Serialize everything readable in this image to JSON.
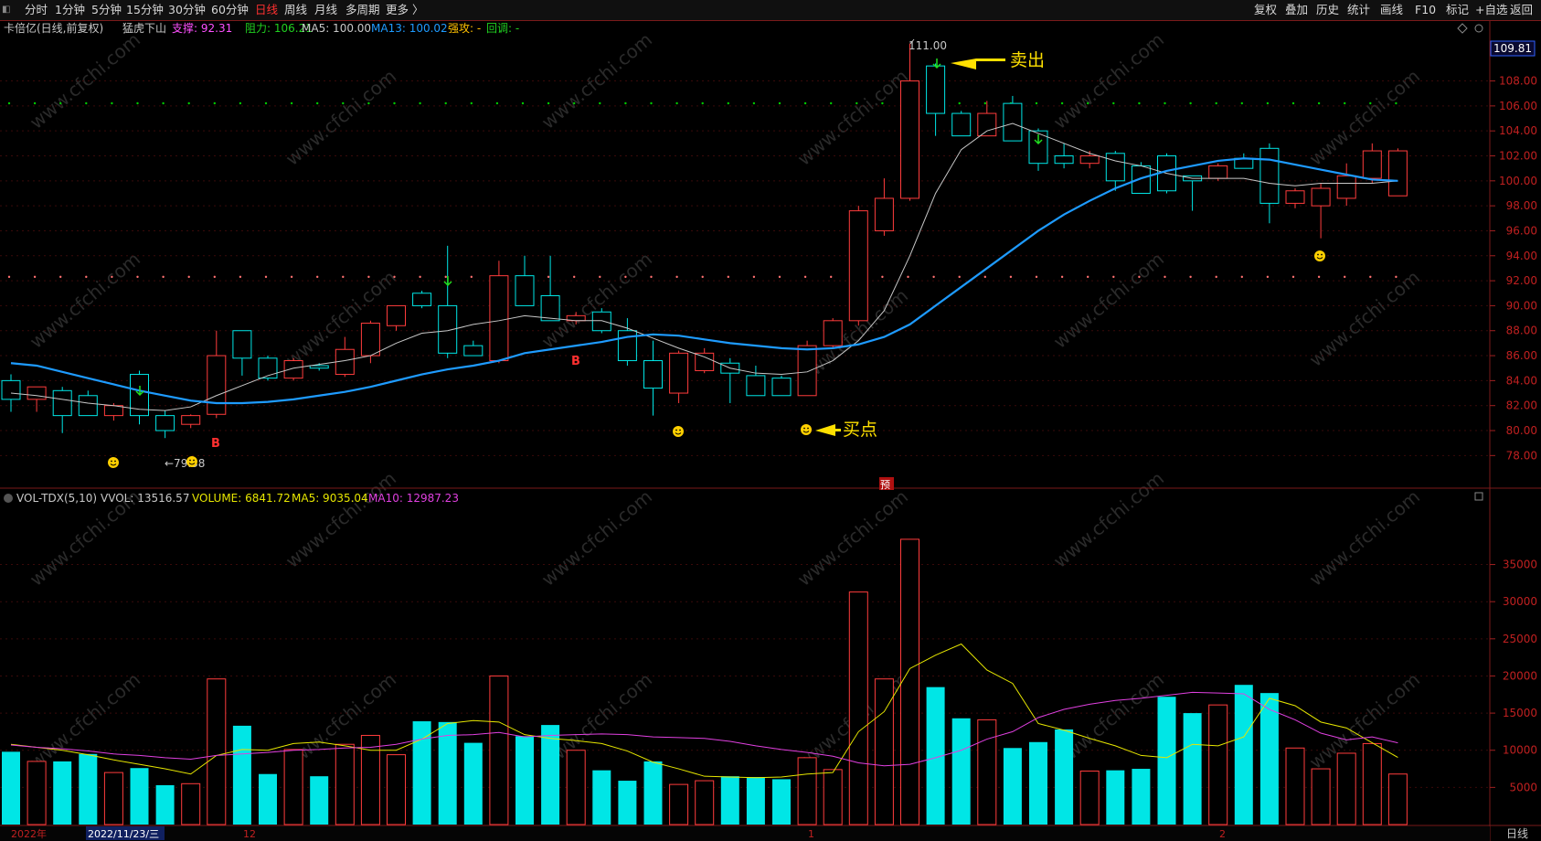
{
  "toolbar": {
    "periods": [
      "分时",
      "1分钟",
      "5分钟",
      "15分钟",
      "30分钟",
      "60分钟",
      "日线",
      "周线",
      "月线",
      "多周期",
      "更多 〉"
    ],
    "active": "日线",
    "right": [
      "复权",
      "叠加",
      "历史",
      "统计",
      "画线",
      "F10",
      "标记",
      "+自选",
      "返回"
    ]
  },
  "main_header": {
    "title": "卡倍亿(日线,前复权)",
    "indicator": "猛虎下山",
    "support": "支撑: 92.31",
    "resistance": "阻力: 106.21",
    "ma5": "MA5: 100.00",
    "ma13": "MA13: 100.02",
    "strong": "强攻: -",
    "pullback": "回调: -"
  },
  "vol_header": {
    "name": "VOL-TDX(5,10)",
    "vvol": "VVOL: 13516.57",
    "volume": "VOLUME: 6841.72",
    "ma5": "MA5: 9035.04",
    "ma10": "MA10: 12987.23"
  },
  "annotations": {
    "sell": "卖出",
    "buy": "买点",
    "high": "111.00",
    "low": "←79.38",
    "b_mark": "B",
    "pre_mark": "预",
    "current_price": "109.81"
  },
  "x_axis": {
    "labels": [
      "2022年",
      "2022/11/23/三",
      "12",
      "1",
      "2"
    ],
    "period": "日线"
  },
  "watermark": "www.cfchi.com",
  "colors": {
    "up": "#ff3c3c",
    "down": "#00e6e6",
    "ma5": "#c8c8c8",
    "ma13": "#1e9bff",
    "vol_ma5": "#e6e600",
    "vol_ma10": "#e040e0",
    "support_dots": "#00cc00",
    "resist_dots": "#ff7070",
    "arrow": "#ffe000"
  },
  "chart_data": [
    {
      "type": "candlestick",
      "title": "卡倍亿(日线,前复权)",
      "ylim": [
        77,
        110.5
      ],
      "yticks": [
        78,
        80,
        82,
        84,
        86,
        88,
        90,
        92,
        94,
        96,
        98,
        100,
        102,
        104,
        106,
        108
      ],
      "support": 92.31,
      "resistance": 106.21,
      "candles": [
        {
          "o": 84,
          "h": 84.5,
          "l": 81.5,
          "c": 82.5
        },
        {
          "o": 82.5,
          "h": 83.5,
          "l": 81.5,
          "c": 83.5
        },
        {
          "o": 83.2,
          "h": 83.5,
          "l": 79.8,
          "c": 81.2
        },
        {
          "o": 82.8,
          "h": 83.2,
          "l": 81.2,
          "c": 81.2
        },
        {
          "o": 81.2,
          "h": 82.2,
          "l": 80.8,
          "c": 82
        },
        {
          "o": 84.5,
          "h": 84.8,
          "l": 80.5,
          "c": 81.2
        },
        {
          "o": 81.2,
          "h": 81.6,
          "l": 79.4,
          "c": 80
        },
        {
          "o": 80.5,
          "h": 81.3,
          "l": 80.2,
          "c": 81.2
        },
        {
          "o": 81.3,
          "h": 88,
          "l": 81,
          "c": 86
        },
        {
          "o": 88,
          "h": 88,
          "l": 84.4,
          "c": 85.8
        },
        {
          "o": 85.8,
          "h": 86,
          "l": 84,
          "c": 84.2
        },
        {
          "o": 84.2,
          "h": 85.8,
          "l": 84,
          "c": 85.6
        },
        {
          "o": 85.2,
          "h": 85.4,
          "l": 84.8,
          "c": 85
        },
        {
          "o": 84.5,
          "h": 87.5,
          "l": 84.3,
          "c": 86.5
        },
        {
          "o": 86,
          "h": 88.8,
          "l": 85.4,
          "c": 88.6
        },
        {
          "o": 88.4,
          "h": 90,
          "l": 88,
          "c": 90
        },
        {
          "o": 91,
          "h": 91.2,
          "l": 89.8,
          "c": 90
        },
        {
          "o": 90,
          "h": 94.8,
          "l": 85.8,
          "c": 86.2
        },
        {
          "o": 86.8,
          "h": 87.2,
          "l": 86,
          "c": 86
        },
        {
          "o": 85.6,
          "h": 93.6,
          "l": 85.4,
          "c": 92.4
        },
        {
          "o": 92.4,
          "h": 94,
          "l": 90.2,
          "c": 90
        },
        {
          "o": 90.8,
          "h": 94,
          "l": 89.4,
          "c": 88.8
        },
        {
          "o": 88.8,
          "h": 89.5,
          "l": 88.5,
          "c": 89.2
        },
        {
          "o": 89.5,
          "h": 89.8,
          "l": 87.8,
          "c": 88
        },
        {
          "o": 88,
          "h": 89,
          "l": 85.2,
          "c": 85.6
        },
        {
          "o": 85.6,
          "h": 87.2,
          "l": 81.2,
          "c": 83.4
        },
        {
          "o": 83,
          "h": 86.4,
          "l": 82.2,
          "c": 86.2
        },
        {
          "o": 84.8,
          "h": 86.6,
          "l": 84.6,
          "c": 86.2
        },
        {
          "o": 85.4,
          "h": 85.8,
          "l": 82.2,
          "c": 84.6
        },
        {
          "o": 84.4,
          "h": 85.2,
          "l": 82.8,
          "c": 82.8
        },
        {
          "o": 84.2,
          "h": 84.4,
          "l": 82.8,
          "c": 82.8
        },
        {
          "o": 82.8,
          "h": 87.2,
          "l": 82.8,
          "c": 86.8
        },
        {
          "o": 86.8,
          "h": 89,
          "l": 86.6,
          "c": 88.8
        },
        {
          "o": 88.8,
          "h": 98,
          "l": 88.4,
          "c": 97.6
        },
        {
          "o": 96,
          "h": 100.2,
          "l": 95.6,
          "c": 98.6
        },
        {
          "o": 98.6,
          "h": 111,
          "l": 98.4,
          "c": 108
        },
        {
          "o": 109.2,
          "h": 109.4,
          "l": 103.6,
          "c": 105.4
        },
        {
          "o": 105.4,
          "h": 105.6,
          "l": 103.6,
          "c": 103.6
        },
        {
          "o": 103.6,
          "h": 106.4,
          "l": 103.6,
          "c": 105.4
        },
        {
          "o": 106.2,
          "h": 106.8,
          "l": 103.2,
          "c": 103.2
        },
        {
          "o": 104,
          "h": 104.2,
          "l": 100.8,
          "c": 101.4
        },
        {
          "o": 102,
          "h": 103,
          "l": 101,
          "c": 101.4
        },
        {
          "o": 101.4,
          "h": 102.4,
          "l": 101,
          "c": 102
        },
        {
          "o": 102.2,
          "h": 102.4,
          "l": 99.2,
          "c": 100
        },
        {
          "o": 101.2,
          "h": 101.5,
          "l": 99,
          "c": 99
        },
        {
          "o": 102,
          "h": 102.2,
          "l": 99,
          "c": 99.2
        },
        {
          "o": 100.4,
          "h": 100.4,
          "l": 97.6,
          "c": 100
        },
        {
          "o": 100.2,
          "h": 101.4,
          "l": 100,
          "c": 101.2
        },
        {
          "o": 101.8,
          "h": 102.2,
          "l": 101,
          "c": 101
        },
        {
          "o": 102.6,
          "h": 103,
          "l": 96.6,
          "c": 98.2
        },
        {
          "o": 98.2,
          "h": 99.4,
          "l": 97.8,
          "c": 99.2
        },
        {
          "o": 98,
          "h": 99.8,
          "l": 95.4,
          "c": 99.4
        },
        {
          "o": 98.6,
          "h": 101.4,
          "l": 98,
          "c": 100.4
        },
        {
          "o": 100.2,
          "h": 103,
          "l": 99.8,
          "c": 102.4
        },
        {
          "o": 98.8,
          "h": 102.6,
          "l": 98.8,
          "c": 102.4
        }
      ],
      "ma5": [
        83,
        82.8,
        82.5,
        82.2,
        82,
        81.7,
        81.6,
        81.9,
        82.8,
        83.6,
        84.4,
        85,
        85.3,
        85.6,
        86,
        87,
        87.8,
        88,
        88.5,
        88.8,
        89.2,
        89,
        88.8,
        88.8,
        88.2,
        87.4,
        86.6,
        85.9,
        85,
        84.6,
        84.5,
        84.7,
        85.6,
        87.2,
        89.6,
        94,
        99,
        102.5,
        104,
        104.6,
        103.8,
        103,
        102.2,
        101.6,
        101.2,
        100.6,
        100.2,
        100.2,
        100.2,
        99.8,
        99.6,
        99.8,
        99.8,
        99.8,
        100
      ],
      "ma13": [
        85.4,
        85.2,
        84.7,
        84.2,
        83.7,
        83.2,
        82.8,
        82.4,
        82.2,
        82.2,
        82.3,
        82.5,
        82.8,
        83.1,
        83.5,
        84,
        84.5,
        84.9,
        85.2,
        85.6,
        86.2,
        86.5,
        86.8,
        87.1,
        87.5,
        87.7,
        87.6,
        87.3,
        87,
        86.8,
        86.6,
        86.5,
        86.6,
        86.9,
        87.5,
        88.5,
        90,
        91.5,
        93,
        94.5,
        96,
        97.3,
        98.4,
        99.4,
        100.2,
        100.8,
        101.2,
        101.6,
        101.8,
        101.7,
        101.3,
        100.9,
        100.5,
        100.1,
        100
      ]
    },
    {
      "type": "bar",
      "title": "VOL-TDX(5,10)",
      "ylim": [
        0,
        40000
      ],
      "yticks": [
        5000,
        10000,
        15000,
        20000,
        25000,
        30000,
        35000
      ],
      "volumes": [
        9800,
        8500,
        8500,
        9500,
        7000,
        7600,
        5300,
        5500,
        19600,
        13300,
        6800,
        10100,
        6500,
        10800,
        12000,
        9400,
        13900,
        13800,
        11000,
        20000,
        11900,
        13400,
        10000,
        7300,
        5900,
        8500,
        5400,
        5900,
        6500,
        6400,
        6100,
        9000,
        7400,
        31300,
        19600,
        38400,
        18500,
        14300,
        14100,
        10300,
        11100,
        12800,
        7200,
        7300,
        7500,
        17200,
        15000,
        16100,
        18800,
        17700,
        10300,
        7500,
        9600,
        10900,
        6800
      ],
      "ma5": [
        10800,
        10400,
        10000,
        9400,
        8700,
        8100,
        7500,
        6800,
        9300,
        10100,
        10000,
        10900,
        11100,
        10600,
        10000,
        10000,
        11500,
        13600,
        14000,
        13800,
        12100,
        11600,
        11300,
        10900,
        9900,
        8400,
        7500,
        6500,
        6400,
        6300,
        6400,
        6800,
        7000,
        12500,
        15200,
        21000,
        22800,
        24300,
        20800,
        19000,
        13600,
        12700,
        11600,
        10600,
        9300,
        9000,
        10800,
        10600,
        11800,
        17000,
        16000,
        13800,
        13000,
        11000,
        9035
      ],
      "ma10": [
        10700,
        10400,
        10200,
        9900,
        9500,
        9300,
        9000,
        8800,
        9300,
        9500,
        9700,
        10000,
        10100,
        10300,
        10400,
        10800,
        11500,
        12000,
        12100,
        12400,
        11800,
        12000,
        12100,
        12200,
        12100,
        11800,
        11700,
        11600,
        11200,
        10600,
        10100,
        9700,
        9200,
        8300,
        7900,
        8100,
        9000,
        10000,
        11500,
        12500,
        14400,
        15500,
        16200,
        16700,
        17000,
        17400,
        17800,
        17700,
        17600,
        15500,
        14100,
        12300,
        11400,
        11800,
        11000,
        12400,
        12600,
        13000,
        12800,
        12987
      ]
    }
  ]
}
